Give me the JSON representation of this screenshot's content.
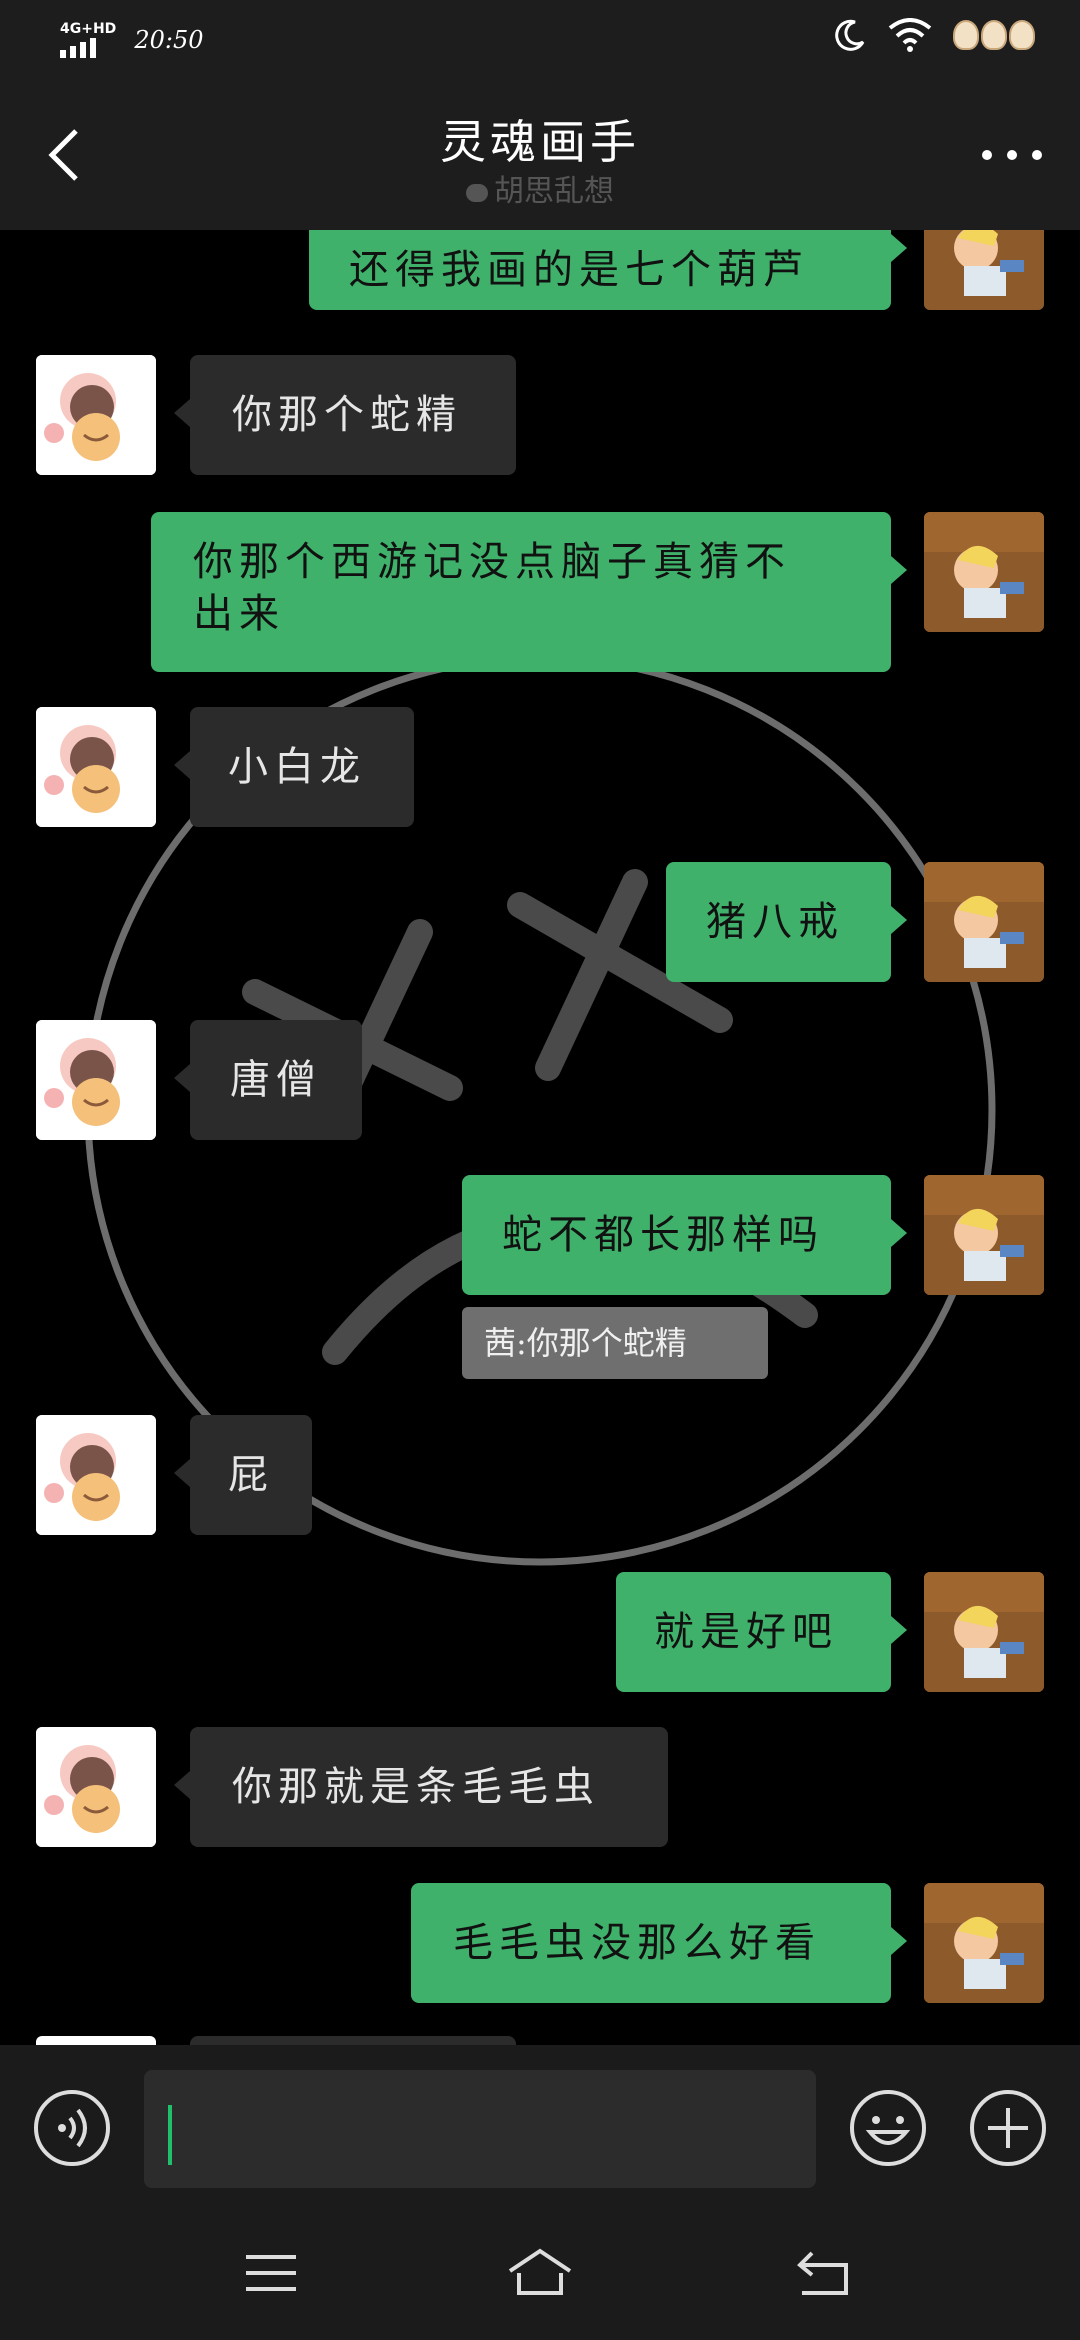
{
  "status_bar": {
    "network": "4G+HD",
    "time": "20:50"
  },
  "header": {
    "title": "灵魂画手",
    "subtitle": "胡思乱想"
  },
  "messages": [
    {
      "side": "right",
      "text": "还得我画的是七个葫芦"
    },
    {
      "side": "left",
      "text": "你那个蛇精"
    },
    {
      "side": "right",
      "line1": "你那个西游记没点脑子真猜不",
      "line2": "出来"
    },
    {
      "side": "left",
      "text": "小白龙"
    },
    {
      "side": "right",
      "text": "猪八戒"
    },
    {
      "side": "left",
      "text": "唐僧"
    },
    {
      "side": "right",
      "text": "蛇不都长那样吗",
      "quote": "茜:你那个蛇精"
    },
    {
      "side": "left",
      "text": "屁"
    },
    {
      "side": "right",
      "text": "就是好吧"
    },
    {
      "side": "left",
      "text": "你那就是条毛毛虫"
    },
    {
      "side": "right",
      "text": "毛毛虫没那么好看"
    }
  ],
  "input": {
    "placeholder": ""
  },
  "icons": {
    "back": "chevron-left-icon",
    "more": "more-dots-icon",
    "voice": "voice-icon",
    "emoji": "emoji-icon",
    "plus": "plus-icon",
    "nav_menu": "menu-icon",
    "nav_home": "home-icon",
    "nav_back": "back-arrow-icon"
  },
  "colors": {
    "sent_bubble": "#3fb16b",
    "received_bubble": "#2b2b2b",
    "background": "#000000",
    "cursor": "#1fbf6b"
  }
}
